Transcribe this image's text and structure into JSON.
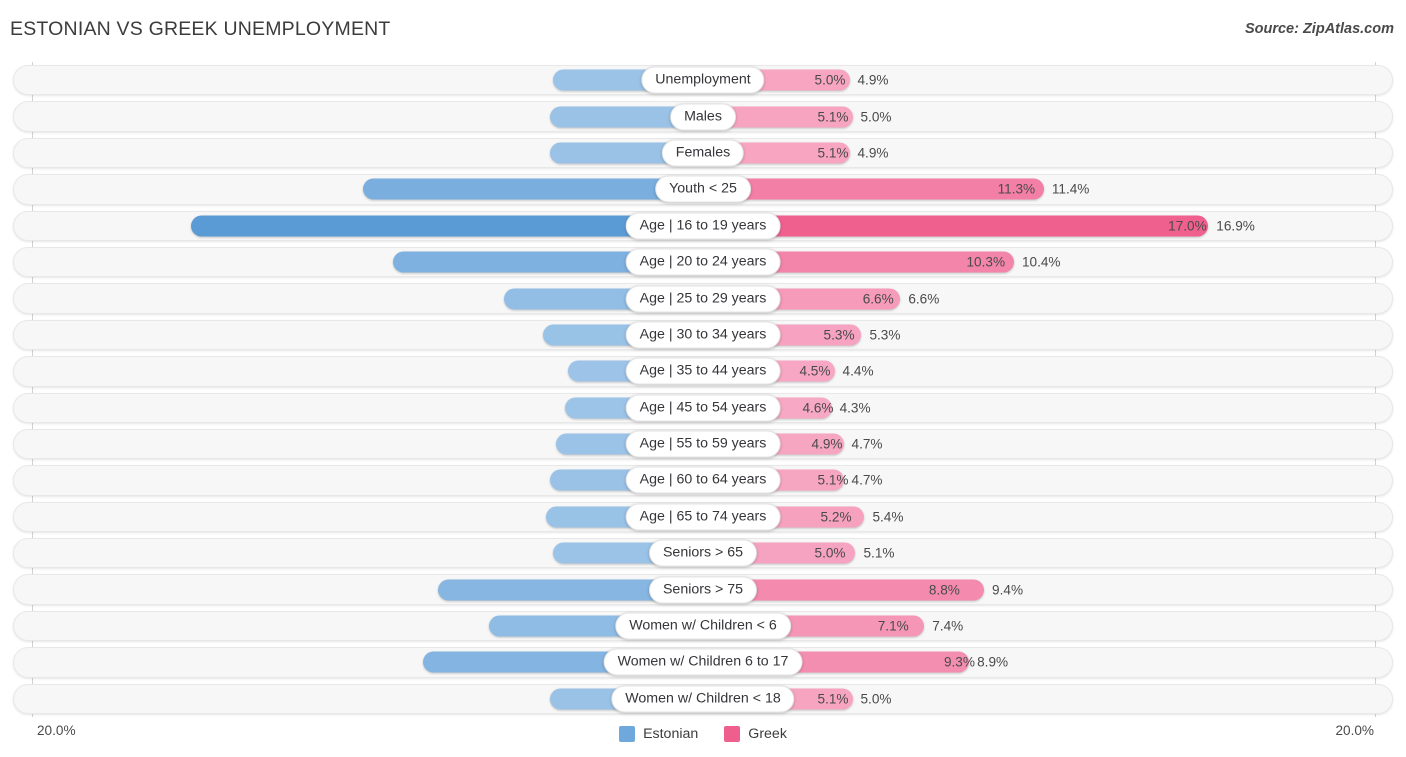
{
  "header": {
    "title": "ESTONIAN VS GREEK UNEMPLOYMENT",
    "source": "Source: ZipAtlas.com"
  },
  "axis": {
    "left_max_label": "20.0%",
    "right_max_label": "20.0%",
    "max_value": 20.0
  },
  "legend": {
    "items": [
      {
        "label": "Estonian",
        "color": "#6fa8dc"
      },
      {
        "label": "Greek",
        "color": "#ef5f8e"
      }
    ]
  },
  "colors": {
    "estonian_light": "#9ec5e8",
    "estonian_mid": "#7fb0e0",
    "estonian_dark": "#5b9bd5",
    "greek_light": "#f7a8c4",
    "greek_mid": "#f486ac",
    "greek_dark": "#ef5f8e",
    "track": "#f7f7f7",
    "axis": "#d2d2d2"
  },
  "chart_data": {
    "type": "bar",
    "title": "ESTONIAN VS GREEK UNEMPLOYMENT",
    "subtitle": "",
    "xlabel": "",
    "ylabel": "",
    "orientation": "horizontal-diverging",
    "xlim": [
      0,
      20.0
    ],
    "grid": false,
    "legend_position": "bottom-center",
    "categories": [
      "Unemployment",
      "Males",
      "Females",
      "Youth < 25",
      "Age | 16 to 19 years",
      "Age | 20 to 24 years",
      "Age | 25 to 29 years",
      "Age | 30 to 34 years",
      "Age | 35 to 44 years",
      "Age | 45 to 54 years",
      "Age | 55 to 59 years",
      "Age | 60 to 64 years",
      "Age | 65 to 74 years",
      "Seniors > 65",
      "Seniors > 75",
      "Women w/ Children < 6",
      "Women w/ Children 6 to 17",
      "Women w/ Children < 18"
    ],
    "series": [
      {
        "name": "Estonian",
        "side": "left",
        "values": [
          5.0,
          5.1,
          5.1,
          11.3,
          17.0,
          10.3,
          6.6,
          5.3,
          4.5,
          4.6,
          4.9,
          5.1,
          5.2,
          5.0,
          8.8,
          7.1,
          9.3,
          5.1
        ],
        "labels": [
          "5.0%",
          "5.1%",
          "5.1%",
          "11.3%",
          "17.0%",
          "10.3%",
          "6.6%",
          "5.3%",
          "4.5%",
          "4.6%",
          "4.9%",
          "5.1%",
          "5.2%",
          "5.0%",
          "8.8%",
          "7.1%",
          "9.3%",
          "5.1%"
        ]
      },
      {
        "name": "Greek",
        "side": "right",
        "values": [
          4.9,
          5.0,
          4.9,
          11.4,
          16.9,
          10.4,
          6.6,
          5.3,
          4.4,
          4.3,
          4.7,
          4.7,
          5.4,
          5.1,
          9.4,
          7.4,
          8.9,
          5.0
        ],
        "labels": [
          "4.9%",
          "5.0%",
          "4.9%",
          "11.4%",
          "16.9%",
          "10.4%",
          "6.6%",
          "5.3%",
          "4.4%",
          "4.3%",
          "4.7%",
          "4.7%",
          "5.4%",
          "5.1%",
          "9.4%",
          "7.4%",
          "8.9%",
          "5.0%"
        ]
      }
    ]
  }
}
